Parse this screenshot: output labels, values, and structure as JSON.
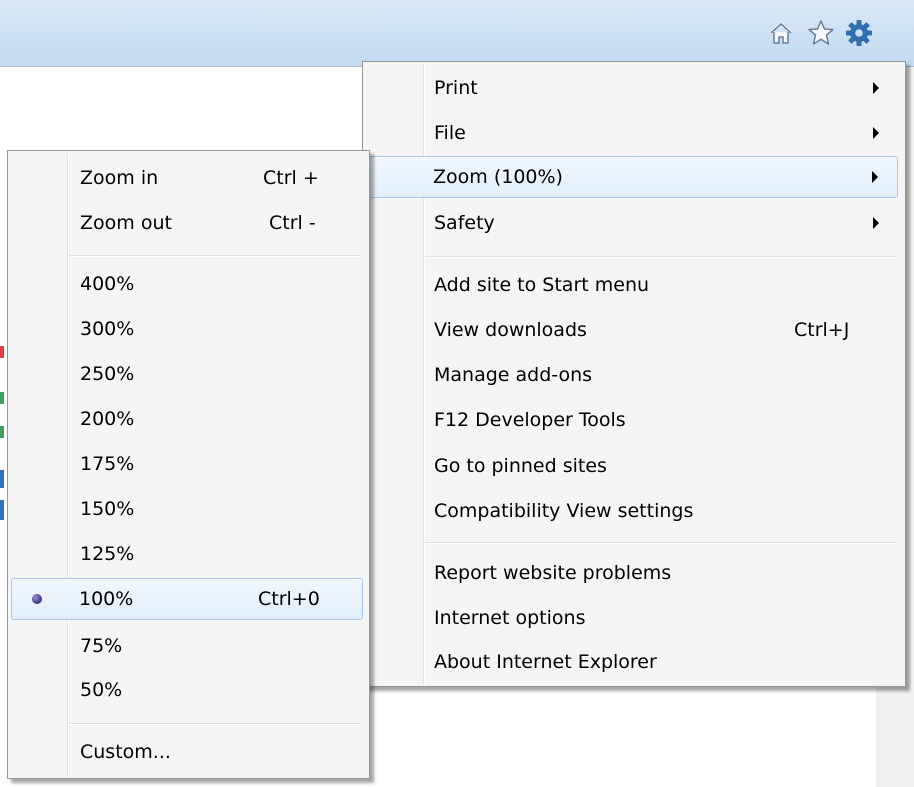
{
  "toolbar": {
    "icons": [
      "home-icon",
      "favorites-star-icon",
      "tools-gear-icon"
    ]
  },
  "tools_menu": {
    "items": [
      {
        "label": "Print",
        "submenu": true
      },
      {
        "label": "File",
        "submenu": true
      },
      {
        "label": "Zoom (100%)",
        "submenu": true,
        "highlighted": true
      },
      {
        "label": "Safety",
        "submenu": true
      },
      {
        "label": "Add site to Start menu"
      },
      {
        "label": "View downloads",
        "shortcut": "Ctrl+J"
      },
      {
        "label": "Manage add-ons"
      },
      {
        "label": "F12 Developer Tools"
      },
      {
        "label": "Go to pinned sites"
      },
      {
        "label": "Compatibility View settings"
      },
      {
        "label": "Report website problems"
      },
      {
        "label": "Internet options"
      },
      {
        "label": "About Internet Explorer"
      }
    ]
  },
  "zoom_menu": {
    "items": [
      {
        "label": "Zoom in",
        "shortcut": "Ctrl +"
      },
      {
        "label": "Zoom out",
        "shortcut": "Ctrl -"
      },
      {
        "label": "400%"
      },
      {
        "label": "300%"
      },
      {
        "label": "250%"
      },
      {
        "label": "200%"
      },
      {
        "label": "175%"
      },
      {
        "label": "150%"
      },
      {
        "label": "125%"
      },
      {
        "label": "100%",
        "shortcut": "Ctrl+0",
        "selected": true
      },
      {
        "label": "75%"
      },
      {
        "label": "50%"
      },
      {
        "label": "Custom..."
      }
    ]
  },
  "colors": {
    "titlebar": "#cadff3",
    "menu_bg": "#f5f5f5",
    "highlight_border": "#a8c8ec"
  }
}
